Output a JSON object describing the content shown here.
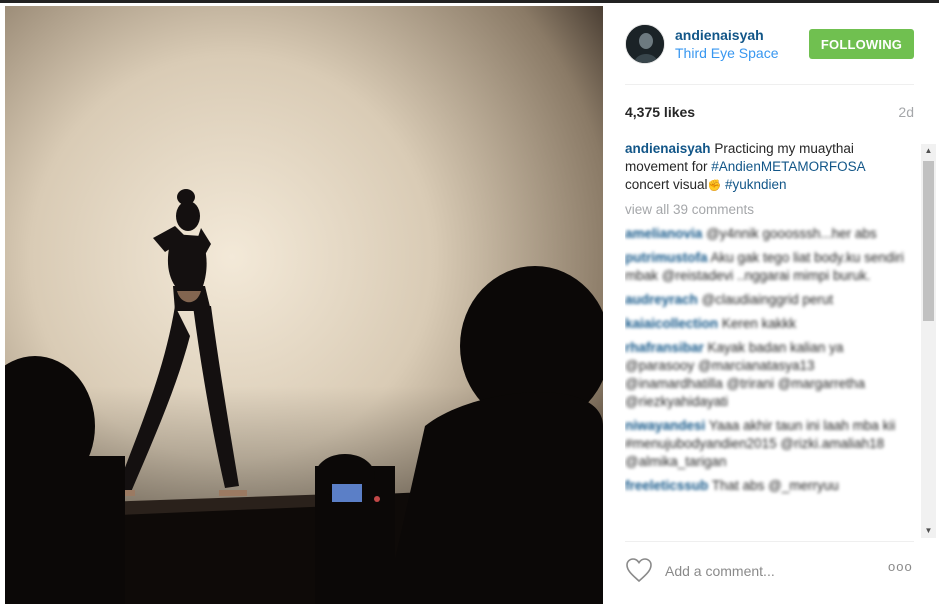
{
  "post": {
    "image_alt": "Performer on stage with raised arms, silhouetted audience in foreground",
    "author": {
      "username": "andienaisyah",
      "location": "Third Eye Space",
      "follow_label": "FOLLOWING"
    },
    "likes": "4,375 likes",
    "age": "2d",
    "caption": {
      "user": "andienaisyah",
      "text_1": "Practicing my muaythai movement for ",
      "tag_1": "#AndienMETAMORFOSA",
      "text_2": " concert visual",
      "tag_2": "#yukndien"
    },
    "view_all_label": "view all 39 comments",
    "comments": [
      {
        "user": "amelianovia",
        "text": "@y4nnik gooosssh...her abs"
      },
      {
        "user": "putrimustofa",
        "text": "Aku gak tego liat body.ku sendiri mbak @reistadevi ..nggarai mimpi buruk."
      },
      {
        "user": "audreyrach",
        "text": "@claudiainggrid perut"
      },
      {
        "user": "kaiaicollection",
        "text": "Keren kakkk"
      },
      {
        "user": "rhafransibar",
        "text": "Kayak badan kalian ya @parasooy @marcianatasya13 @inamardhatilla @trirani @margarretha @riezkyahidayati"
      },
      {
        "user": "niwayandesi",
        "text": "Yaaa akhir taun ini laah mba kii #menujubodyandien2015 @rizki.amaliah18 @almika_tarigan"
      },
      {
        "user": "freeleticssub",
        "text": "That abs @_merryuu"
      }
    ],
    "add_comment_placeholder": "Add a comment...",
    "more_label": "ooo"
  },
  "icons": {
    "heart": "heart-icon",
    "more": "more-options-icon",
    "emoji": "fist-emoji-icon"
  },
  "colors": {
    "username": "#125688",
    "location": "#3897f0",
    "follow_button": "#70c050",
    "muted": "#a5a7aa"
  }
}
